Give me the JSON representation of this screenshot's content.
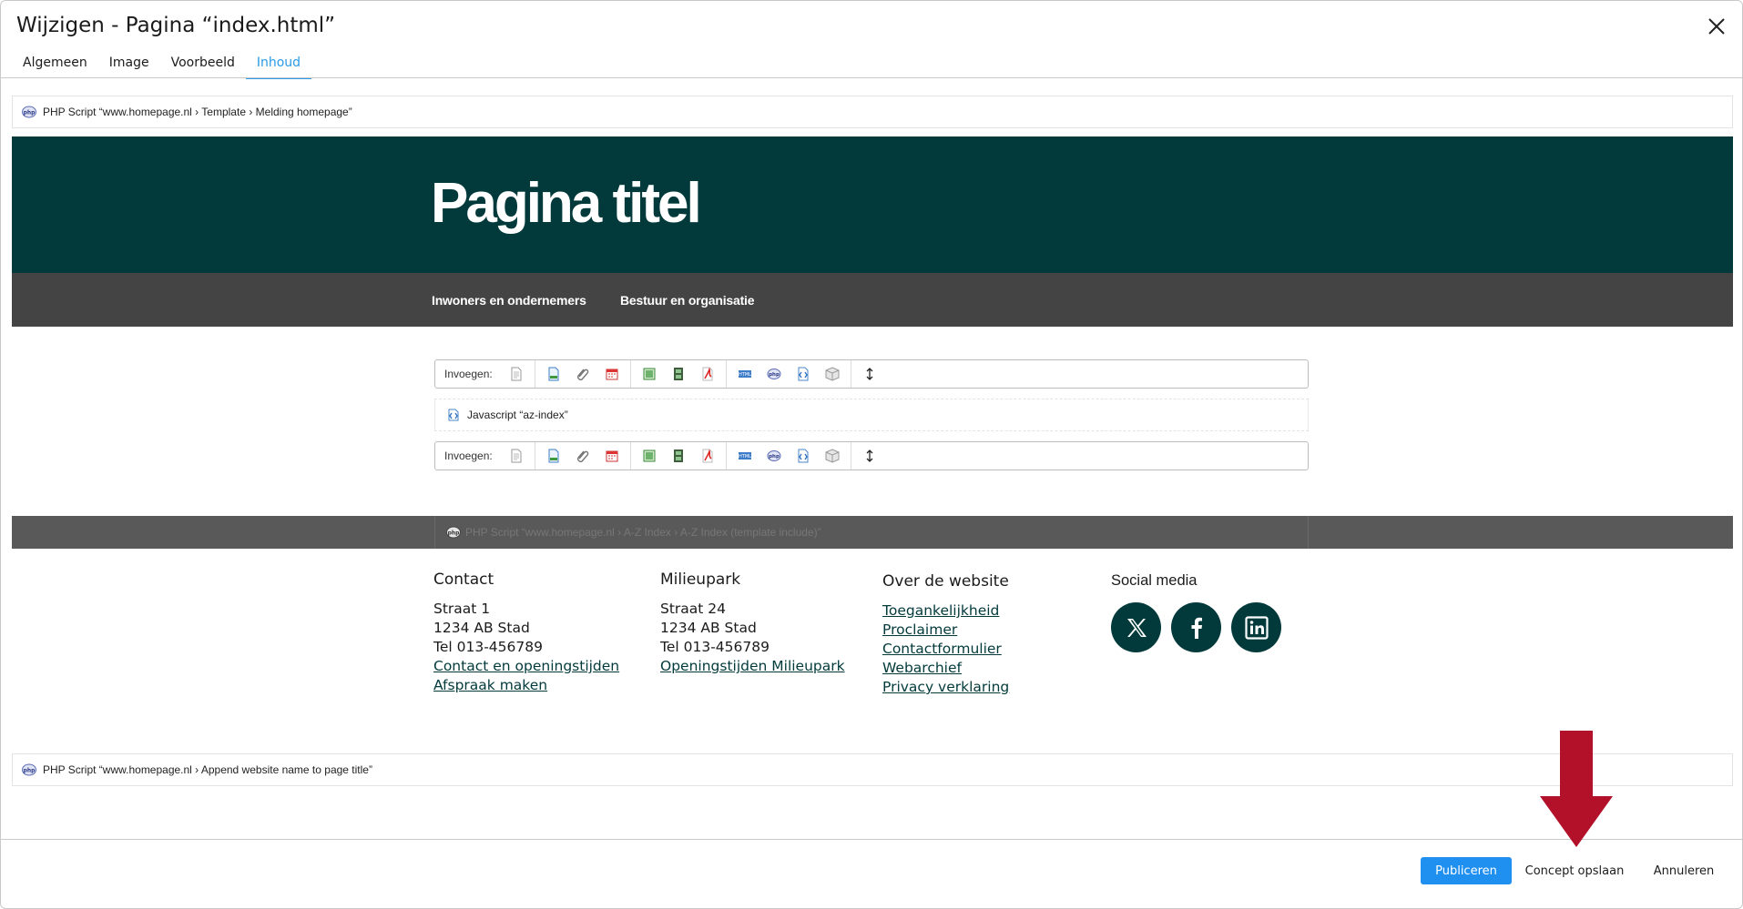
{
  "dialog": {
    "title": "Wijzigen - Pagina “index.html”"
  },
  "tabs": [
    {
      "label": "Algemeen"
    },
    {
      "label": "Image"
    },
    {
      "label": "Voorbeeld"
    },
    {
      "label": "Inhoud",
      "active": true
    }
  ],
  "script_bars": {
    "top": "PHP Script “www.homepage.nl › Template › Melding homepage”",
    "middle": "PHP Script “www.homepage.nl › A-Z Index › A-Z Index (template include)”",
    "bottom": "PHP Script “www.homepage.nl › Append website name to page title”"
  },
  "hero": {
    "title": "Pagina titel",
    "background": "#023a3b"
  },
  "nav": {
    "items": [
      {
        "label": "Inwoners en ondernemers"
      },
      {
        "label": "Bestuur en organisatie"
      }
    ]
  },
  "toolbar": {
    "label": "Invoegen:",
    "icons": [
      "page-icon",
      "document-icon",
      "attachment-icon",
      "calendar-icon",
      "image-icon",
      "film-icon",
      "pdf-icon",
      "html-icon",
      "php-icon",
      "javascript-icon",
      "package-icon",
      "resize-icon"
    ]
  },
  "js_block": {
    "label": "Javascript “az-index”"
  },
  "footer": {
    "contact": {
      "title": "Contact",
      "lines": [
        "Straat 1",
        "1234 AB  Stad",
        "Tel 013-456789"
      ],
      "links": [
        "Contact en openingstijden",
        "Afspraak maken"
      ]
    },
    "milieupark": {
      "title": "Milieupark",
      "lines": [
        "Straat 24",
        "1234 AB  Stad",
        "Tel 013-456789"
      ],
      "links": [
        "Openingstijden Milieupark"
      ]
    },
    "website": {
      "title": "Over de website",
      "links": [
        "Toegankelijkheid",
        "Proclaimer",
        "Contactformulier",
        "Webarchief",
        "Privacy verklaring"
      ]
    },
    "social": {
      "title": "Social media",
      "icons": [
        "x-icon",
        "facebook-icon",
        "linkedin-icon"
      ]
    }
  },
  "actions": {
    "publish": "Publiceren",
    "save_draft": "Concept opslaan",
    "cancel": "Annuleren"
  },
  "colors": {
    "accent": "#2a9be6",
    "primary_button": "#1f8ff0",
    "brand_dark": "#023a3b",
    "nav_bg": "#444444",
    "arrow": "#b3102a"
  }
}
